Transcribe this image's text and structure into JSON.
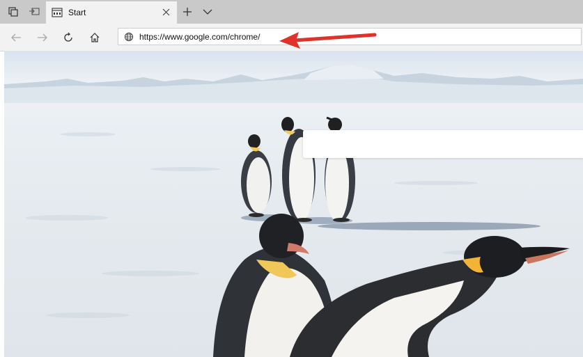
{
  "tabs": [
    {
      "title": "Start"
    }
  ],
  "address_bar": {
    "url": "https://www.google.com/chrome/"
  },
  "colors": {
    "annotation_arrow": "#e0312b",
    "tabbar_bg": "#c9c9c9",
    "active_tab_bg": "#f2f2f2"
  },
  "icons": {
    "tab_actions": [
      "tabs-aside-icon",
      "set-aside-icon"
    ],
    "tab_favicon": "new-tab-page-icon",
    "tab_close": "close-icon",
    "new_tab": "plus-icon",
    "tab_preview": "chevron-down-icon",
    "nav": [
      "back-arrow-icon",
      "forward-arrow-icon",
      "refresh-icon",
      "home-icon"
    ],
    "address": "globe-icon"
  }
}
